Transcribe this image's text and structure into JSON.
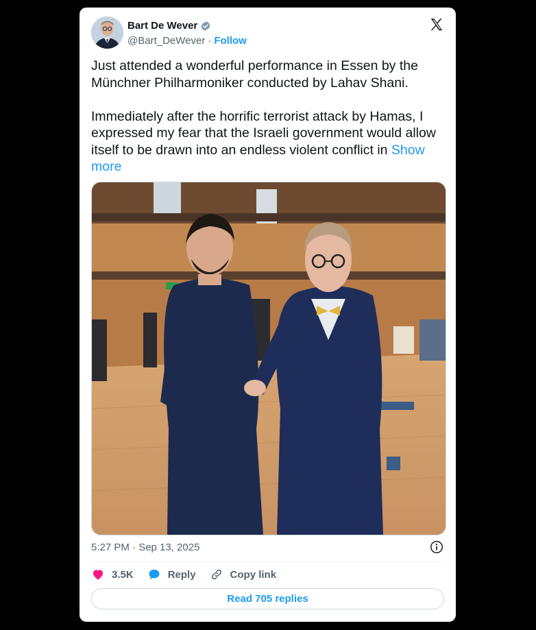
{
  "author": {
    "name": "Bart De Wever",
    "handle": "@Bart_DeWever",
    "separator": "·",
    "follow_label": "Follow"
  },
  "post": {
    "paragraph1": "Just attended a wonderful performance in Essen by the Münchner Philharmoniker conducted by Lahav Shani.",
    "paragraph2": "Immediately after the horrific terrorist attack by Hamas, I expressed my fear that the Israeli government would allow itself to be drawn into an endless violent conflict in ",
    "show_more": "Show more",
    "timestamp": "5:27 PM · Sep 13, 2025"
  },
  "actions": {
    "likes": "3.5K",
    "reply_label": "Reply",
    "copy_label": "Copy link"
  },
  "replies_button": "Read 705 replies",
  "colors": {
    "accent": "#1d9bf0",
    "like": "#f91880",
    "text": "#0f1419",
    "muted": "#536471"
  },
  "icons": [
    "verified-badge-icon",
    "x-logo-icon",
    "info-icon",
    "heart-icon",
    "reply-bubble-icon",
    "link-icon"
  ]
}
